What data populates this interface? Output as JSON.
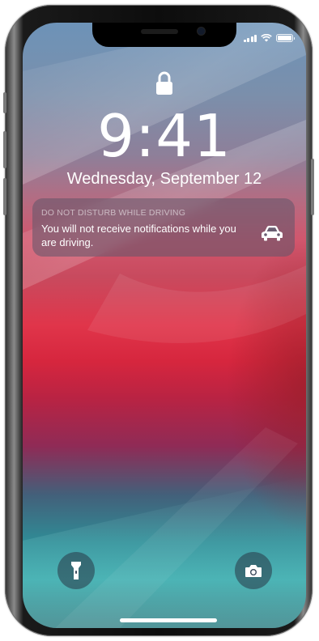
{
  "lockscreen": {
    "time": "9:41",
    "date": "Wednesday, September 12"
  },
  "notification": {
    "title": "DO NOT DISTURB WHILE DRIVING",
    "body": "You will not receive notifications while you are driving.",
    "icon": "car-icon"
  },
  "status_bar": {
    "signal_icon": "cellular-signal-icon",
    "wifi_icon": "wifi-icon",
    "battery_icon": "battery-icon"
  },
  "bottom_controls": {
    "left": "flashlight-icon",
    "right": "camera-icon"
  },
  "colors": {
    "text": "#ffffff",
    "notification_bg": "#5f5569"
  }
}
